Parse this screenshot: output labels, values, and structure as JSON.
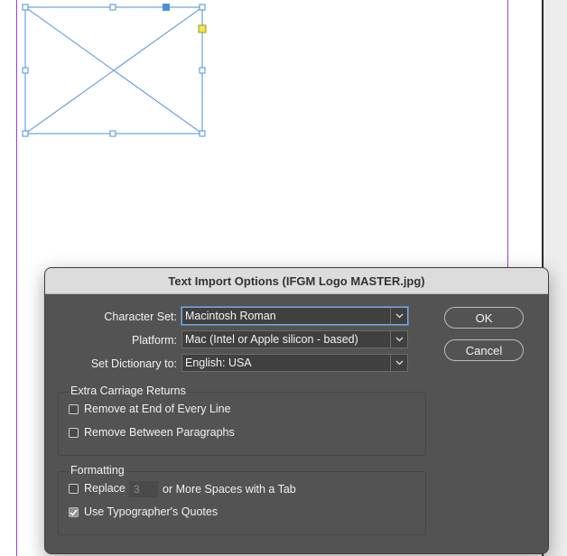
{
  "dialog": {
    "title": "Text Import Options (IFGM Logo MASTER.jpg)",
    "character_set": {
      "label": "Character Set:",
      "value": "Macintosh Roman"
    },
    "platform": {
      "label": "Platform:",
      "value": "Mac (Intel or Apple silicon - based)"
    },
    "dictionary": {
      "label": "Set Dictionary to:",
      "value": "English: USA"
    },
    "ok_label": "OK",
    "cancel_label": "Cancel",
    "extra_returns": {
      "title": "Extra Carriage Returns",
      "remove_end_of_line": {
        "label": "Remove at End of Every Line",
        "checked": false
      },
      "remove_between_paragraphs": {
        "label": "Remove Between Paragraphs",
        "checked": false
      }
    },
    "formatting": {
      "title": "Formatting",
      "replace": {
        "label": "Replace",
        "checked": false,
        "spaces_value": "3",
        "suffix": "or More Spaces with a Tab"
      },
      "typographers_quotes": {
        "label": "Use Typographer's Quotes",
        "checked": true
      }
    }
  },
  "colors": {
    "dialog_bg": "#535353",
    "titlebar_bg": "#dcdcdc",
    "frame_stroke": "#4a90d9",
    "margin_guide": "#9a3fd6",
    "handle_highlight": "#f0e64a"
  },
  "icons": [
    "chevron-down-icon",
    "checkmark-icon"
  ]
}
